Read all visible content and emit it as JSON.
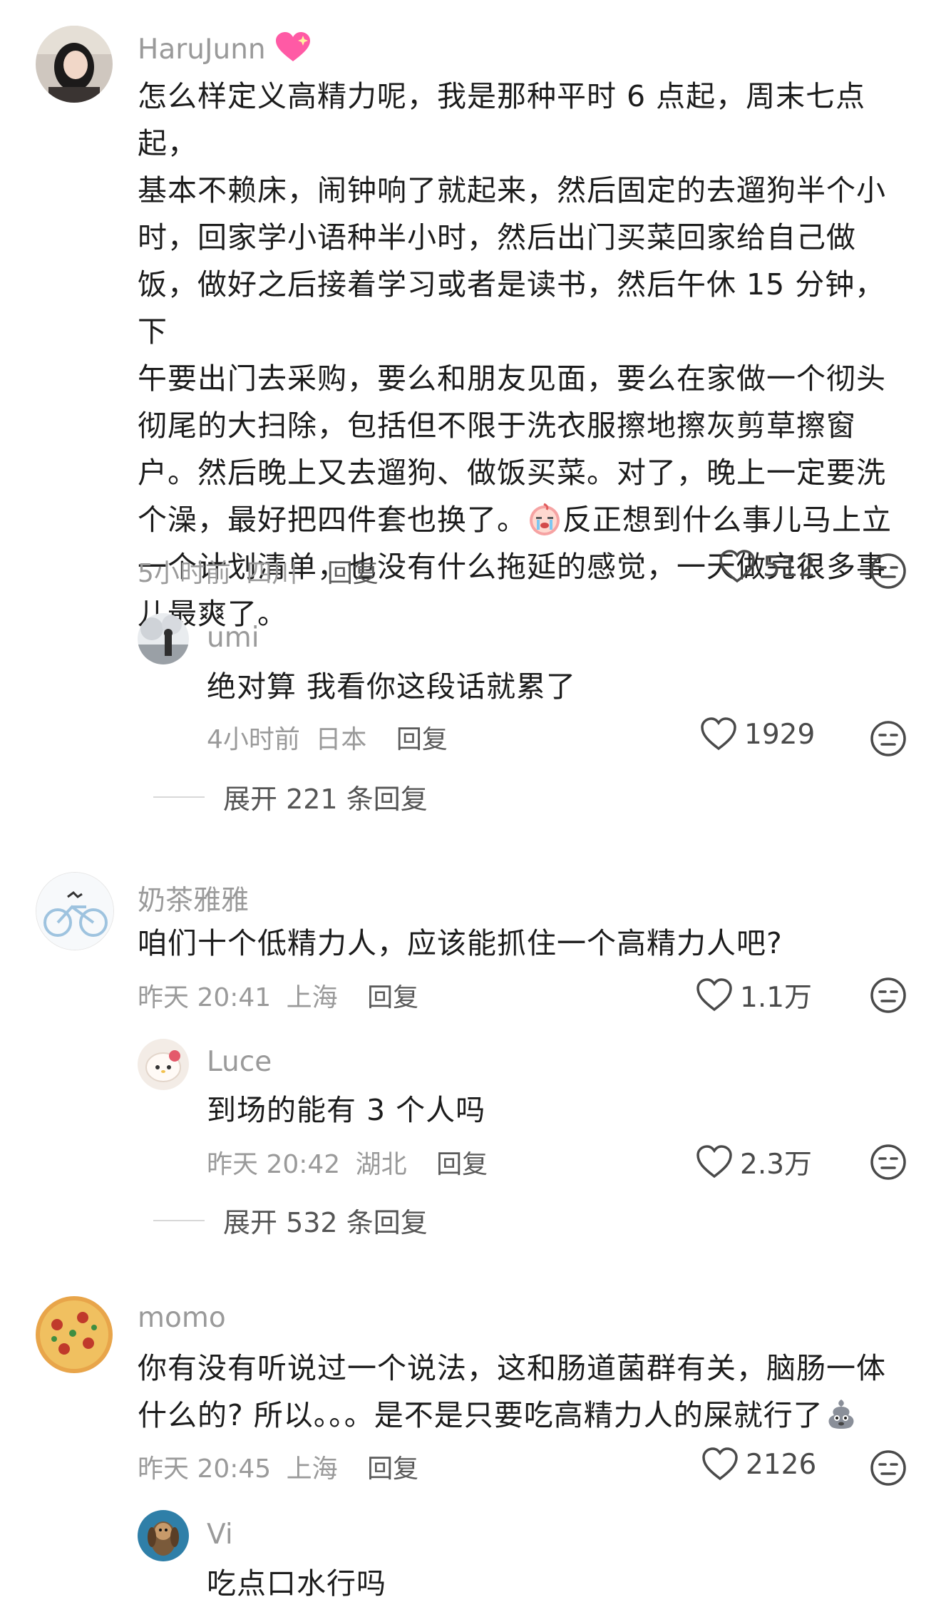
{
  "comments": [
    {
      "user": "HaruJunn",
      "text_lines": [
        "怎么样定义高精力呢，我是那种平时 6 点起，周末七点起，",
        "基本不赖床，闹钟响了就起来，然后固定的去遛狗半个小",
        "时，回家学小语种半小时，然后出门买菜回家给自己做",
        "饭，做好之后接着学习或者是读书，然后午休 15 分钟，下",
        "午要出门去采购，要么和朋友见面，要么在家做一个彻头",
        "彻尾的大扫除，包括但不限于洗衣服擦地擦灰剪草擦窗",
        "户。然后晚上又去遛狗、做饭买菜。对了，晚上一定要洗",
        "个澡，最好把四件套也换了。",
        "反正想到什么事儿马上立",
        "一个计划清单，也没有什么拖延的感觉，一天做完很多事",
        "儿最爽了。"
      ],
      "time": "5小时前",
      "location": "四川",
      "reply_label": "回复",
      "likes": "512"
    },
    {
      "user": "umi",
      "text": "绝对算 我看你这段话就累了",
      "time": "4小时前",
      "location": "日本",
      "reply_label": "回复",
      "likes": "1929",
      "expand": "展开 221 条回复"
    },
    {
      "user": "奶茶雅雅",
      "text": "咱们十个低精力人，应该能抓住一个高精力人吧?",
      "time": "昨天 20:41",
      "location": "上海",
      "reply_label": "回复",
      "likes": "1.1万"
    },
    {
      "user": "Luce",
      "text": "到场的能有 3 个人吗",
      "time": "昨天 20:42",
      "location": "湖北",
      "reply_label": "回复",
      "likes": "2.3万",
      "expand": "展开 532 条回复"
    },
    {
      "user": "momo",
      "text_lines": [
        "你有没有听说过一个说法，这和肠道菌群有关，脑肠一体",
        "什么的? 所以。。。是不是只要吃高精力人的屎就行了"
      ],
      "time": "昨天 20:45",
      "location": "上海",
      "reply_label": "回复",
      "likes": "2126"
    },
    {
      "user": "Vi",
      "text": "吃点口水行吗"
    }
  ],
  "icons": {
    "like": "heart-outline-icon",
    "dislike": "unamused-face-icon",
    "heart_emoji": "sparkling-heart-emoji",
    "cry_emoji": "crying-face-emoji",
    "poop_emoji": "poop-emoji"
  },
  "colors": {
    "text": "#1c1c1c",
    "meta": "#9a9a9a",
    "pink": "#ff5aa5"
  }
}
